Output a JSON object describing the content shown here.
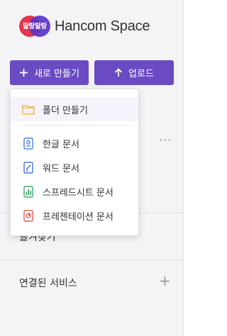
{
  "logo": {
    "badge_text": "말랑말랑",
    "wordmark": "Hancom Space"
  },
  "actions": {
    "new_label": "새로 만들기",
    "upload_label": "업로드"
  },
  "more_label": "···",
  "menu": {
    "create_folder": "폴더 만들기",
    "items": [
      {
        "label": "한글 문서",
        "icon": "hwp-doc-icon",
        "color": "#2b6fd6"
      },
      {
        "label": "워드 문서",
        "icon": "word-doc-icon",
        "color": "#2b5fd6"
      },
      {
        "label": "스프레드시트 문서",
        "icon": "spreadsheet-doc-icon",
        "color": "#1f9a55"
      },
      {
        "label": "프레젠테이션 문서",
        "icon": "presentation-doc-icon",
        "color": "#e0453a"
      }
    ]
  },
  "nav": {
    "favorites_partial": "즐겨찾기",
    "connected_services": "연결된 서비스",
    "add_symbol": "+"
  },
  "colors": {
    "accent": "#6a4bc4",
    "folder": "#f2b12a"
  }
}
